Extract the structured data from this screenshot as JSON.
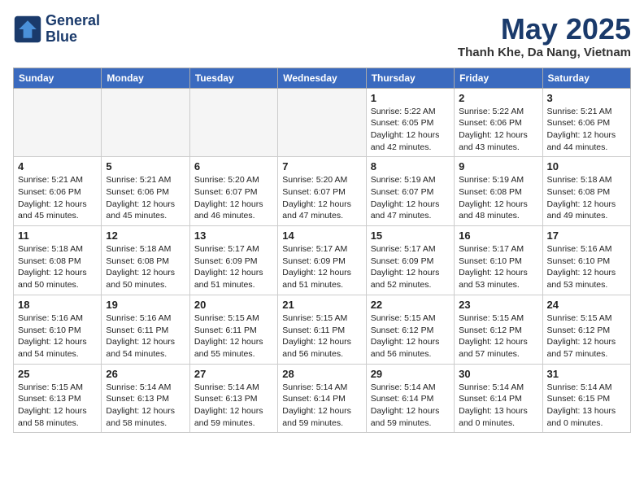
{
  "header": {
    "logo_line1": "General",
    "logo_line2": "Blue",
    "month": "May 2025",
    "location": "Thanh Khe, Da Nang, Vietnam"
  },
  "days_of_week": [
    "Sunday",
    "Monday",
    "Tuesday",
    "Wednesday",
    "Thursday",
    "Friday",
    "Saturday"
  ],
  "weeks": [
    [
      {
        "day": "",
        "info": ""
      },
      {
        "day": "",
        "info": ""
      },
      {
        "day": "",
        "info": ""
      },
      {
        "day": "",
        "info": ""
      },
      {
        "day": "1",
        "info": "Sunrise: 5:22 AM\nSunset: 6:05 PM\nDaylight: 12 hours\nand 42 minutes."
      },
      {
        "day": "2",
        "info": "Sunrise: 5:22 AM\nSunset: 6:06 PM\nDaylight: 12 hours\nand 43 minutes."
      },
      {
        "day": "3",
        "info": "Sunrise: 5:21 AM\nSunset: 6:06 PM\nDaylight: 12 hours\nand 44 minutes."
      }
    ],
    [
      {
        "day": "4",
        "info": "Sunrise: 5:21 AM\nSunset: 6:06 PM\nDaylight: 12 hours\nand 45 minutes."
      },
      {
        "day": "5",
        "info": "Sunrise: 5:21 AM\nSunset: 6:06 PM\nDaylight: 12 hours\nand 45 minutes."
      },
      {
        "day": "6",
        "info": "Sunrise: 5:20 AM\nSunset: 6:07 PM\nDaylight: 12 hours\nand 46 minutes."
      },
      {
        "day": "7",
        "info": "Sunrise: 5:20 AM\nSunset: 6:07 PM\nDaylight: 12 hours\nand 47 minutes."
      },
      {
        "day": "8",
        "info": "Sunrise: 5:19 AM\nSunset: 6:07 PM\nDaylight: 12 hours\nand 47 minutes."
      },
      {
        "day": "9",
        "info": "Sunrise: 5:19 AM\nSunset: 6:08 PM\nDaylight: 12 hours\nand 48 minutes."
      },
      {
        "day": "10",
        "info": "Sunrise: 5:18 AM\nSunset: 6:08 PM\nDaylight: 12 hours\nand 49 minutes."
      }
    ],
    [
      {
        "day": "11",
        "info": "Sunrise: 5:18 AM\nSunset: 6:08 PM\nDaylight: 12 hours\nand 50 minutes."
      },
      {
        "day": "12",
        "info": "Sunrise: 5:18 AM\nSunset: 6:08 PM\nDaylight: 12 hours\nand 50 minutes."
      },
      {
        "day": "13",
        "info": "Sunrise: 5:17 AM\nSunset: 6:09 PM\nDaylight: 12 hours\nand 51 minutes."
      },
      {
        "day": "14",
        "info": "Sunrise: 5:17 AM\nSunset: 6:09 PM\nDaylight: 12 hours\nand 51 minutes."
      },
      {
        "day": "15",
        "info": "Sunrise: 5:17 AM\nSunset: 6:09 PM\nDaylight: 12 hours\nand 52 minutes."
      },
      {
        "day": "16",
        "info": "Sunrise: 5:17 AM\nSunset: 6:10 PM\nDaylight: 12 hours\nand 53 minutes."
      },
      {
        "day": "17",
        "info": "Sunrise: 5:16 AM\nSunset: 6:10 PM\nDaylight: 12 hours\nand 53 minutes."
      }
    ],
    [
      {
        "day": "18",
        "info": "Sunrise: 5:16 AM\nSunset: 6:10 PM\nDaylight: 12 hours\nand 54 minutes."
      },
      {
        "day": "19",
        "info": "Sunrise: 5:16 AM\nSunset: 6:11 PM\nDaylight: 12 hours\nand 54 minutes."
      },
      {
        "day": "20",
        "info": "Sunrise: 5:15 AM\nSunset: 6:11 PM\nDaylight: 12 hours\nand 55 minutes."
      },
      {
        "day": "21",
        "info": "Sunrise: 5:15 AM\nSunset: 6:11 PM\nDaylight: 12 hours\nand 56 minutes."
      },
      {
        "day": "22",
        "info": "Sunrise: 5:15 AM\nSunset: 6:12 PM\nDaylight: 12 hours\nand 56 minutes."
      },
      {
        "day": "23",
        "info": "Sunrise: 5:15 AM\nSunset: 6:12 PM\nDaylight: 12 hours\nand 57 minutes."
      },
      {
        "day": "24",
        "info": "Sunrise: 5:15 AM\nSunset: 6:12 PM\nDaylight: 12 hours\nand 57 minutes."
      }
    ],
    [
      {
        "day": "25",
        "info": "Sunrise: 5:15 AM\nSunset: 6:13 PM\nDaylight: 12 hours\nand 58 minutes."
      },
      {
        "day": "26",
        "info": "Sunrise: 5:14 AM\nSunset: 6:13 PM\nDaylight: 12 hours\nand 58 minutes."
      },
      {
        "day": "27",
        "info": "Sunrise: 5:14 AM\nSunset: 6:13 PM\nDaylight: 12 hours\nand 59 minutes."
      },
      {
        "day": "28",
        "info": "Sunrise: 5:14 AM\nSunset: 6:14 PM\nDaylight: 12 hours\nand 59 minutes."
      },
      {
        "day": "29",
        "info": "Sunrise: 5:14 AM\nSunset: 6:14 PM\nDaylight: 12 hours\nand 59 minutes."
      },
      {
        "day": "30",
        "info": "Sunrise: 5:14 AM\nSunset: 6:14 PM\nDaylight: 13 hours\nand 0 minutes."
      },
      {
        "day": "31",
        "info": "Sunrise: 5:14 AM\nSunset: 6:15 PM\nDaylight: 13 hours\nand 0 minutes."
      }
    ]
  ]
}
